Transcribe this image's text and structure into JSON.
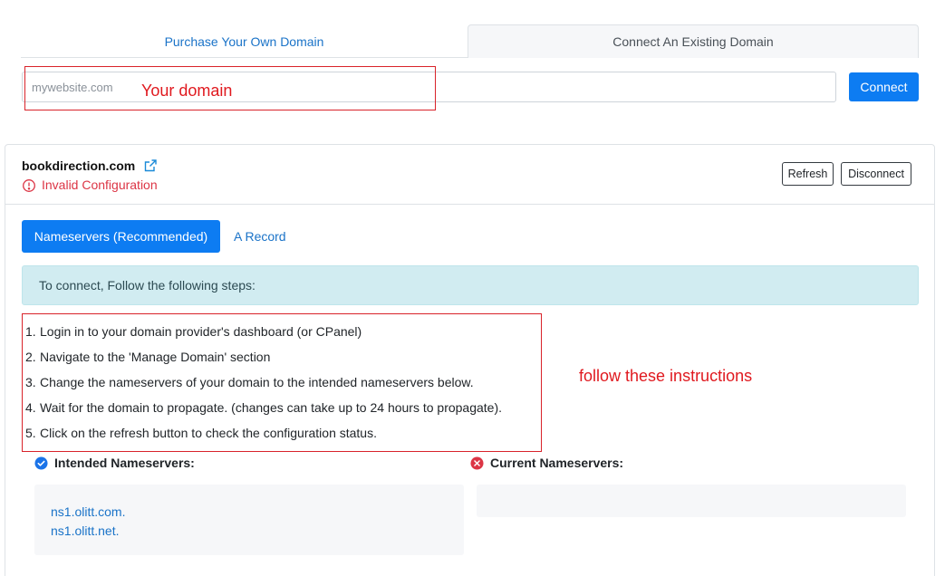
{
  "top_tabs": {
    "purchase_label": "Purchase Your Own Domain",
    "connect_label": "Connect An Existing Domain"
  },
  "domain_form": {
    "placeholder": "mywebsite.com",
    "value": "",
    "connect_label": "Connect"
  },
  "annotations": {
    "domain_note": "Your domain",
    "steps_note": "follow these instructions",
    "color": "#e0191f"
  },
  "card": {
    "domain": "bookdirection.com",
    "status": "Invalid Configuration",
    "refresh_label": "Refresh",
    "disconnect_label": "Disconnect",
    "tabs": [
      {
        "label": "Nameservers (Recommended)",
        "active": true
      },
      {
        "label": "A Record",
        "active": false
      }
    ],
    "alert_text": "To connect, Follow the following steps:",
    "steps": [
      {
        "num": "1.",
        "text": "Login in to your domain provider's dashboard (or CPanel)"
      },
      {
        "num": "2.",
        "text": "Navigate to the 'Manage Domain' section"
      },
      {
        "num": "3.",
        "text": "Change the nameservers of your domain to the intended nameservers below."
      },
      {
        "num": "4.",
        "text": "Wait for the domain to propagate. (changes can take up to 24 hours to propagate)."
      },
      {
        "num": "5.",
        "text": "Click on the refresh button to check the configuration status."
      }
    ],
    "intended_heading": "Intended Nameservers:",
    "current_heading": "Current Nameservers:",
    "intended_nameservers": [
      "ns1.olitt.com.",
      "ns1.olitt.net."
    ],
    "current_nameservers": []
  },
  "colors": {
    "primary": "#0d7cf2",
    "link": "#1a73c8",
    "danger": "#dc3545",
    "alert_bg": "#d1ecf1"
  },
  "icons": {
    "external": "external-link-icon",
    "status": "alert-circle-icon",
    "intended": "check-circle-icon",
    "current": "x-circle-icon"
  }
}
